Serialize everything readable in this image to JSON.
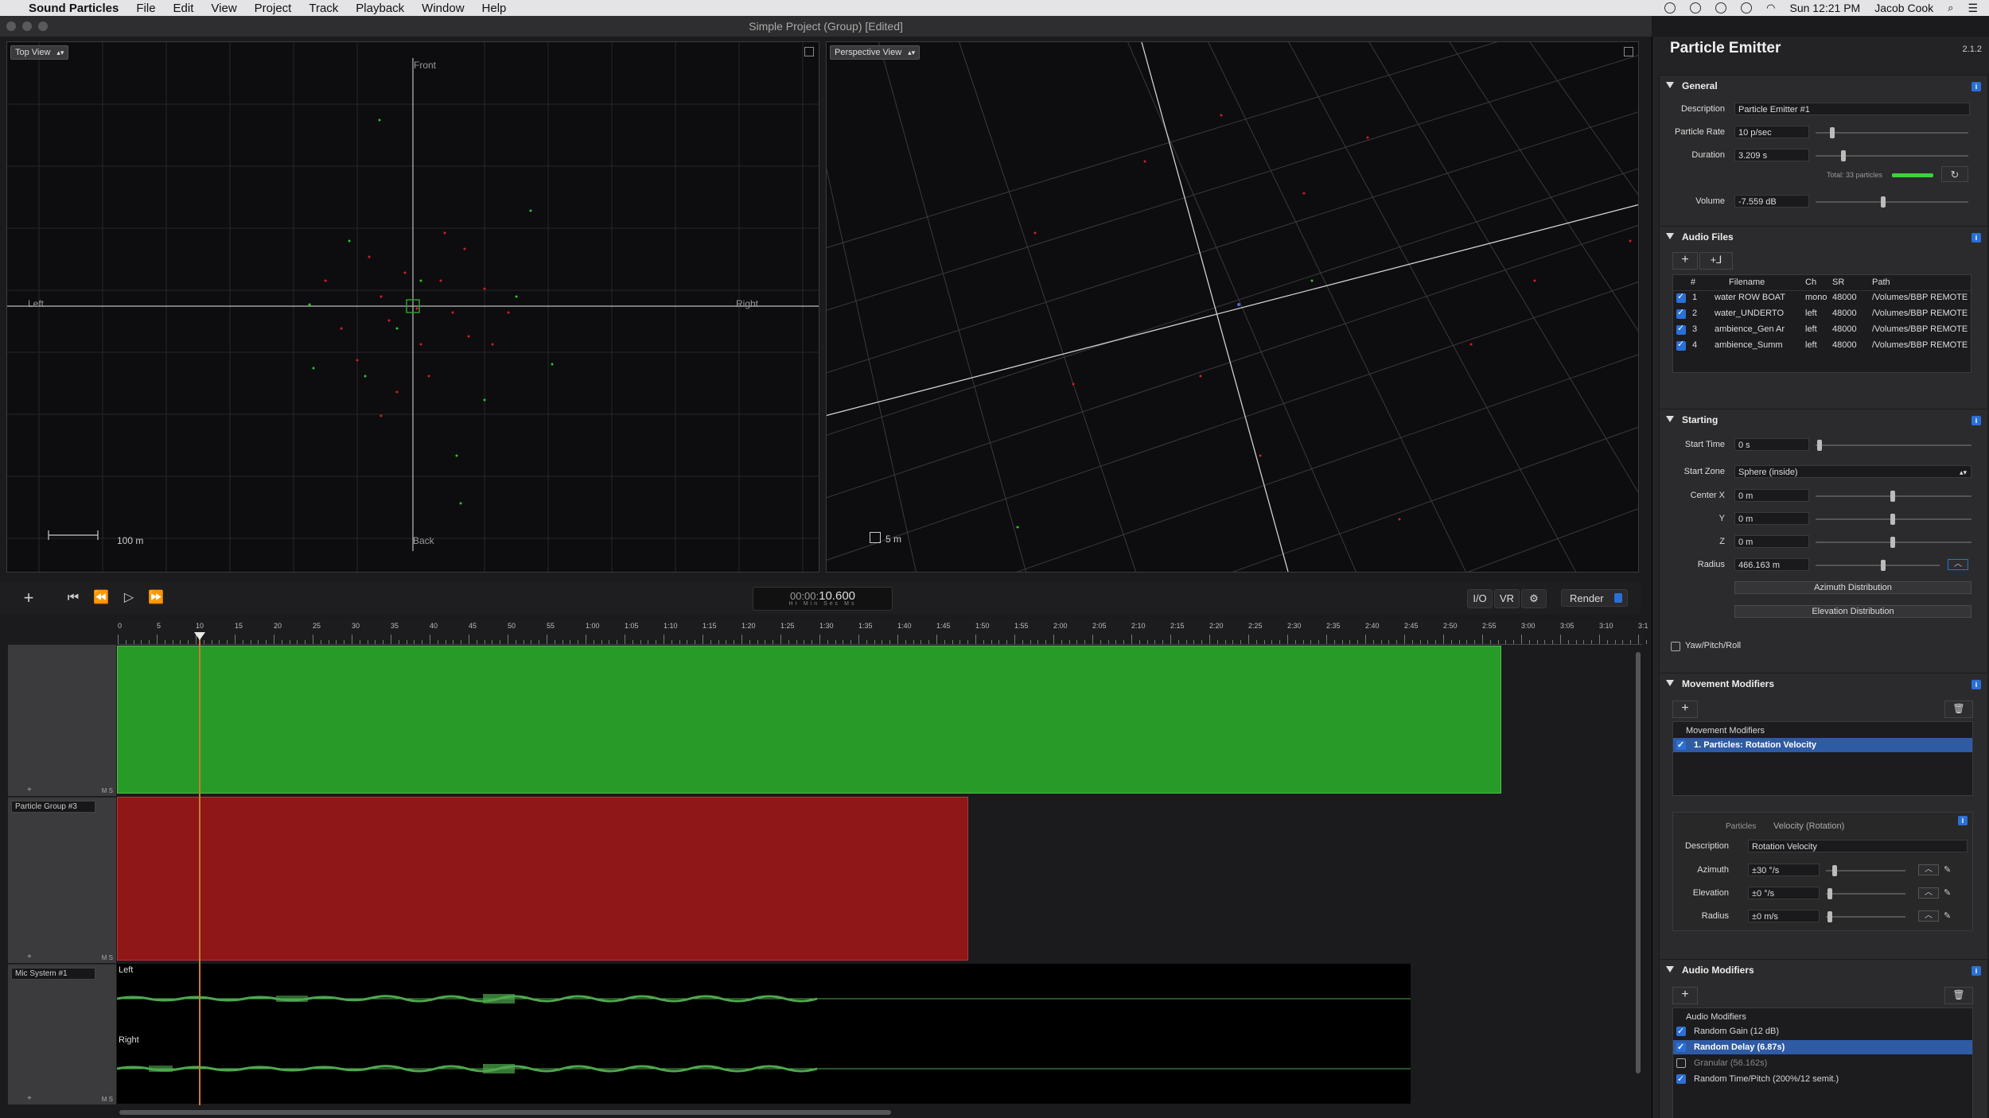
{
  "menubar": {
    "app_name": "Sound Particles",
    "items": [
      "File",
      "Edit",
      "View",
      "Project",
      "Track",
      "Playback",
      "Window",
      "Help"
    ],
    "clock": "Sun 12:21 PM",
    "user": "Jacob Cook"
  },
  "window": {
    "title": "Simple Project (Group) [Edited]"
  },
  "top_view": {
    "mode": "Top View",
    "label_front": "Front",
    "label_back": "Back",
    "label_left": "Left",
    "label_right": "Right",
    "scale": "100 m"
  },
  "perspective_view": {
    "mode": "Perspective View",
    "scale": "5 m"
  },
  "transport": {
    "timecode": "00:00:10.600",
    "timecode_prefix": "00:00:",
    "timecode_main": "10.600",
    "timecode_units": "Hr Min Sec Ms",
    "io_label": "I/O",
    "vr_label": "VR",
    "render_label": "Render"
  },
  "ruler": {
    "labels": [
      "0",
      "5",
      "10",
      "15",
      "20",
      "25",
      "30",
      "35",
      "40",
      "45",
      "50",
      "55",
      "1:00",
      "1:05",
      "1:10",
      "1:15",
      "1:20",
      "1:25",
      "1:30",
      "1:35",
      "1:40",
      "1:45",
      "1:50",
      "1:55",
      "2:00",
      "2:05",
      "2:10",
      "2:15",
      "2:20",
      "2:25",
      "2:30",
      "2:35",
      "2:40",
      "2:45",
      "2:50",
      "2:55",
      "3:00",
      "3:05",
      "3:10",
      "3:1"
    ]
  },
  "tracks": [
    {
      "name": "",
      "color": "#2a9a2a"
    },
    {
      "name": "Particle Group #3",
      "color": "#a01b1b"
    },
    {
      "name": "Mic System #1",
      "wave_left": "Left",
      "wave_right": "Right"
    }
  ],
  "inspector": {
    "title": "Particle Emitter",
    "version": "2.1.2",
    "general": {
      "title": "General",
      "description_label": "Description",
      "description": "Particle Emitter #1",
      "rate_label": "Particle Rate",
      "rate": "10 p/sec",
      "duration_label": "Duration",
      "duration": "3.209 s",
      "total": "Total: 33 particles",
      "volume_label": "Volume",
      "volume": "-7.559 dB"
    },
    "audio_files": {
      "title": "Audio Files",
      "columns": [
        "#",
        "Filename",
        "Ch",
        "SR",
        "Path"
      ],
      "rows": [
        {
          "n": "1",
          "file": "water ROW BOAT",
          "ch": "mono",
          "sr": "48000",
          "path": "/Volumes/BBP REMOTE I"
        },
        {
          "n": "2",
          "file": "water_UNDERTO",
          "ch": "left",
          "sr": "48000",
          "path": "/Volumes/BBP REMOTE I"
        },
        {
          "n": "3",
          "file": "ambience_Gen Ar",
          "ch": "left",
          "sr": "48000",
          "path": "/Volumes/BBP REMOTE I"
        },
        {
          "n": "4",
          "file": "ambience_Summ",
          "ch": "left",
          "sr": "48000",
          "path": "/Volumes/BBP REMOTE I"
        }
      ]
    },
    "starting": {
      "title": "Starting",
      "start_time_label": "Start Time",
      "start_time": "0 s",
      "start_zone_label": "Start Zone",
      "start_zone": "Sphere (inside)",
      "center_x_label": "Center  X",
      "center_x": "0 m",
      "y_label": "Y",
      "y": "0 m",
      "z_label": "Z",
      "z": "0 m",
      "radius_label": "Radius",
      "radius": "466.163 m",
      "azimuth_btn": "Azimuth Distribution",
      "elevation_btn": "Elevation Distribution",
      "ypr_label": "Yaw/Pitch/Roll"
    },
    "movement": {
      "title": "Movement Modifiers",
      "list_header": "Movement Modifiers",
      "items": [
        "1. Particles: Rotation Velocity"
      ],
      "detail_category": "Particles",
      "detail_type": "Velocity (Rotation)",
      "desc_label": "Description",
      "desc": "Rotation Velocity",
      "azimuth_label": "Azimuth",
      "azimuth": "±30 °/s",
      "elevation_label": "Elevation",
      "elevation": "±0 °/s",
      "radius_label": "Radius",
      "radius": "±0 m/s"
    },
    "audio_mods": {
      "title": "Audio Modifiers",
      "list_header": "Audio Modifiers",
      "items": [
        {
          "label": "Random Gain (12 dB)",
          "on": true,
          "selected": false
        },
        {
          "label": "Random Delay (6.87s)",
          "on": true,
          "selected": true
        },
        {
          "label": "Granular (56.162s)",
          "on": false,
          "selected": false
        },
        {
          "label": "Random Time/Pitch (200%/12 semit.)",
          "on": true,
          "selected": false
        }
      ]
    }
  }
}
